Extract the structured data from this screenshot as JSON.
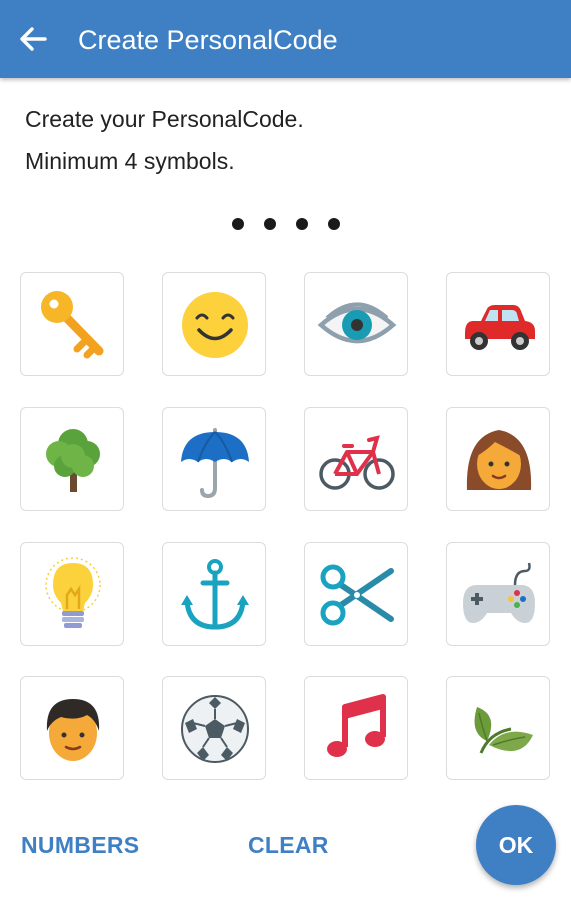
{
  "app_bar": {
    "title": "Create PersonalCode",
    "back_icon": "arrow-left-icon",
    "color": "#3f80c4"
  },
  "instructions": {
    "line1": "Create your PersonalCode.",
    "line2": "Minimum 4 symbols."
  },
  "code_indicator": {
    "entered_count": 4
  },
  "symbols": [
    {
      "icon": "key-icon"
    },
    {
      "icon": "smiley-face-icon"
    },
    {
      "icon": "eye-icon"
    },
    {
      "icon": "car-icon"
    },
    {
      "icon": "tree-icon"
    },
    {
      "icon": "umbrella-icon"
    },
    {
      "icon": "bicycle-icon"
    },
    {
      "icon": "woman-face-icon"
    },
    {
      "icon": "light-bulb-icon"
    },
    {
      "icon": "anchor-icon"
    },
    {
      "icon": "scissors-icon"
    },
    {
      "icon": "game-controller-icon"
    },
    {
      "icon": "man-face-icon"
    },
    {
      "icon": "soccer-ball-icon"
    },
    {
      "icon": "music-note-icon"
    },
    {
      "icon": "leaves-icon"
    }
  ],
  "buttons": {
    "numbers": "NUMBERS",
    "clear": "CLEAR",
    "ok": "OK"
  }
}
